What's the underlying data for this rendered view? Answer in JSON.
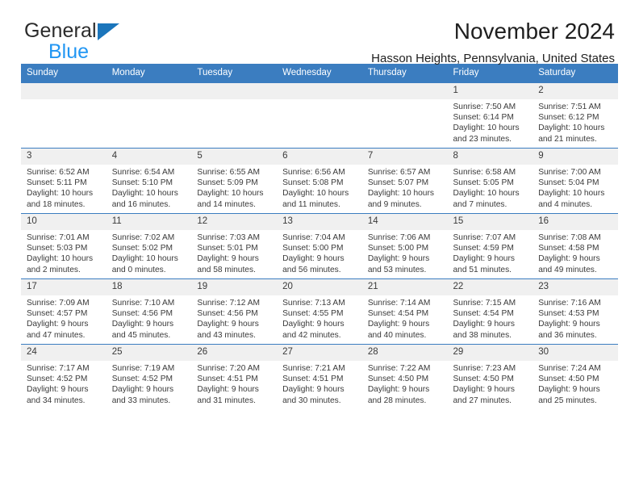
{
  "brand": {
    "name_part1": "General",
    "name_part2": "Blue",
    "logo_icon": "triangle-logo-icon"
  },
  "header": {
    "title": "November 2024",
    "subtitle": "Hasson Heights, Pennsylvania, United States"
  },
  "colors": {
    "header_blue": "#3b7dc0",
    "brand_blue": "#2196f3",
    "logo_blue": "#1b75bb",
    "daynum_bg": "#f0f0f0"
  },
  "calendar": {
    "weekday_headers": [
      "Sunday",
      "Monday",
      "Tuesday",
      "Wednesday",
      "Thursday",
      "Friday",
      "Saturday"
    ],
    "weeks": [
      [
        {
          "day": "",
          "sunrise": "",
          "sunset": "",
          "daylight1": "",
          "daylight2": ""
        },
        {
          "day": "",
          "sunrise": "",
          "sunset": "",
          "daylight1": "",
          "daylight2": ""
        },
        {
          "day": "",
          "sunrise": "",
          "sunset": "",
          "daylight1": "",
          "daylight2": ""
        },
        {
          "day": "",
          "sunrise": "",
          "sunset": "",
          "daylight1": "",
          "daylight2": ""
        },
        {
          "day": "",
          "sunrise": "",
          "sunset": "",
          "daylight1": "",
          "daylight2": ""
        },
        {
          "day": "1",
          "sunrise": "Sunrise: 7:50 AM",
          "sunset": "Sunset: 6:14 PM",
          "daylight1": "Daylight: 10 hours",
          "daylight2": "and 23 minutes."
        },
        {
          "day": "2",
          "sunrise": "Sunrise: 7:51 AM",
          "sunset": "Sunset: 6:12 PM",
          "daylight1": "Daylight: 10 hours",
          "daylight2": "and 21 minutes."
        }
      ],
      [
        {
          "day": "3",
          "sunrise": "Sunrise: 6:52 AM",
          "sunset": "Sunset: 5:11 PM",
          "daylight1": "Daylight: 10 hours",
          "daylight2": "and 18 minutes."
        },
        {
          "day": "4",
          "sunrise": "Sunrise: 6:54 AM",
          "sunset": "Sunset: 5:10 PM",
          "daylight1": "Daylight: 10 hours",
          "daylight2": "and 16 minutes."
        },
        {
          "day": "5",
          "sunrise": "Sunrise: 6:55 AM",
          "sunset": "Sunset: 5:09 PM",
          "daylight1": "Daylight: 10 hours",
          "daylight2": "and 14 minutes."
        },
        {
          "day": "6",
          "sunrise": "Sunrise: 6:56 AM",
          "sunset": "Sunset: 5:08 PM",
          "daylight1": "Daylight: 10 hours",
          "daylight2": "and 11 minutes."
        },
        {
          "day": "7",
          "sunrise": "Sunrise: 6:57 AM",
          "sunset": "Sunset: 5:07 PM",
          "daylight1": "Daylight: 10 hours",
          "daylight2": "and 9 minutes."
        },
        {
          "day": "8",
          "sunrise": "Sunrise: 6:58 AM",
          "sunset": "Sunset: 5:05 PM",
          "daylight1": "Daylight: 10 hours",
          "daylight2": "and 7 minutes."
        },
        {
          "day": "9",
          "sunrise": "Sunrise: 7:00 AM",
          "sunset": "Sunset: 5:04 PM",
          "daylight1": "Daylight: 10 hours",
          "daylight2": "and 4 minutes."
        }
      ],
      [
        {
          "day": "10",
          "sunrise": "Sunrise: 7:01 AM",
          "sunset": "Sunset: 5:03 PM",
          "daylight1": "Daylight: 10 hours",
          "daylight2": "and 2 minutes."
        },
        {
          "day": "11",
          "sunrise": "Sunrise: 7:02 AM",
          "sunset": "Sunset: 5:02 PM",
          "daylight1": "Daylight: 10 hours",
          "daylight2": "and 0 minutes."
        },
        {
          "day": "12",
          "sunrise": "Sunrise: 7:03 AM",
          "sunset": "Sunset: 5:01 PM",
          "daylight1": "Daylight: 9 hours",
          "daylight2": "and 58 minutes."
        },
        {
          "day": "13",
          "sunrise": "Sunrise: 7:04 AM",
          "sunset": "Sunset: 5:00 PM",
          "daylight1": "Daylight: 9 hours",
          "daylight2": "and 56 minutes."
        },
        {
          "day": "14",
          "sunrise": "Sunrise: 7:06 AM",
          "sunset": "Sunset: 5:00 PM",
          "daylight1": "Daylight: 9 hours",
          "daylight2": "and 53 minutes."
        },
        {
          "day": "15",
          "sunrise": "Sunrise: 7:07 AM",
          "sunset": "Sunset: 4:59 PM",
          "daylight1": "Daylight: 9 hours",
          "daylight2": "and 51 minutes."
        },
        {
          "day": "16",
          "sunrise": "Sunrise: 7:08 AM",
          "sunset": "Sunset: 4:58 PM",
          "daylight1": "Daylight: 9 hours",
          "daylight2": "and 49 minutes."
        }
      ],
      [
        {
          "day": "17",
          "sunrise": "Sunrise: 7:09 AM",
          "sunset": "Sunset: 4:57 PM",
          "daylight1": "Daylight: 9 hours",
          "daylight2": "and 47 minutes."
        },
        {
          "day": "18",
          "sunrise": "Sunrise: 7:10 AM",
          "sunset": "Sunset: 4:56 PM",
          "daylight1": "Daylight: 9 hours",
          "daylight2": "and 45 minutes."
        },
        {
          "day": "19",
          "sunrise": "Sunrise: 7:12 AM",
          "sunset": "Sunset: 4:56 PM",
          "daylight1": "Daylight: 9 hours",
          "daylight2": "and 43 minutes."
        },
        {
          "day": "20",
          "sunrise": "Sunrise: 7:13 AM",
          "sunset": "Sunset: 4:55 PM",
          "daylight1": "Daylight: 9 hours",
          "daylight2": "and 42 minutes."
        },
        {
          "day": "21",
          "sunrise": "Sunrise: 7:14 AM",
          "sunset": "Sunset: 4:54 PM",
          "daylight1": "Daylight: 9 hours",
          "daylight2": "and 40 minutes."
        },
        {
          "day": "22",
          "sunrise": "Sunrise: 7:15 AM",
          "sunset": "Sunset: 4:54 PM",
          "daylight1": "Daylight: 9 hours",
          "daylight2": "and 38 minutes."
        },
        {
          "day": "23",
          "sunrise": "Sunrise: 7:16 AM",
          "sunset": "Sunset: 4:53 PM",
          "daylight1": "Daylight: 9 hours",
          "daylight2": "and 36 minutes."
        }
      ],
      [
        {
          "day": "24",
          "sunrise": "Sunrise: 7:17 AM",
          "sunset": "Sunset: 4:52 PM",
          "daylight1": "Daylight: 9 hours",
          "daylight2": "and 34 minutes."
        },
        {
          "day": "25",
          "sunrise": "Sunrise: 7:19 AM",
          "sunset": "Sunset: 4:52 PM",
          "daylight1": "Daylight: 9 hours",
          "daylight2": "and 33 minutes."
        },
        {
          "day": "26",
          "sunrise": "Sunrise: 7:20 AM",
          "sunset": "Sunset: 4:51 PM",
          "daylight1": "Daylight: 9 hours",
          "daylight2": "and 31 minutes."
        },
        {
          "day": "27",
          "sunrise": "Sunrise: 7:21 AM",
          "sunset": "Sunset: 4:51 PM",
          "daylight1": "Daylight: 9 hours",
          "daylight2": "and 30 minutes."
        },
        {
          "day": "28",
          "sunrise": "Sunrise: 7:22 AM",
          "sunset": "Sunset: 4:50 PM",
          "daylight1": "Daylight: 9 hours",
          "daylight2": "and 28 minutes."
        },
        {
          "day": "29",
          "sunrise": "Sunrise: 7:23 AM",
          "sunset": "Sunset: 4:50 PM",
          "daylight1": "Daylight: 9 hours",
          "daylight2": "and 27 minutes."
        },
        {
          "day": "30",
          "sunrise": "Sunrise: 7:24 AM",
          "sunset": "Sunset: 4:50 PM",
          "daylight1": "Daylight: 9 hours",
          "daylight2": "and 25 minutes."
        }
      ]
    ]
  }
}
